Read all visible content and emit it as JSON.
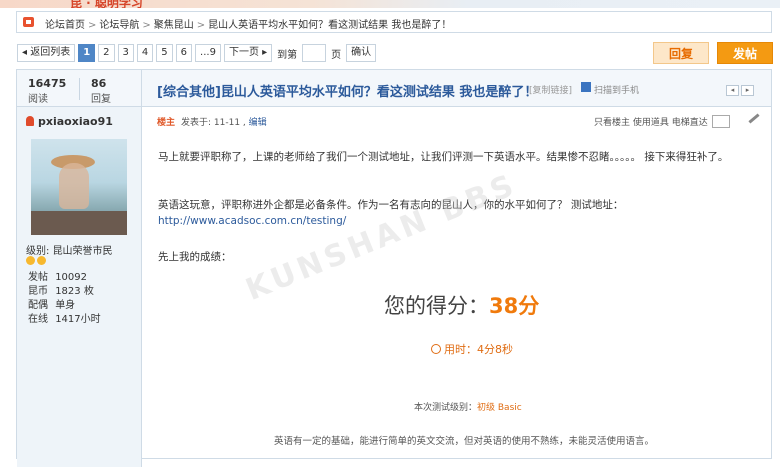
{
  "banner": {
    "text": "昆 · 聪明学习"
  },
  "breadcrumb": {
    "items": [
      "论坛首页",
      "论坛导航",
      "聚焦昆山",
      "昆山人英语平均水平如何？看这测试结果 我也是醉了！"
    ],
    "separator": ">"
  },
  "pager": {
    "back": "◂ 返回列表",
    "pages": [
      "1",
      "2",
      "3",
      "4",
      "5",
      "6",
      "...9"
    ],
    "next": "下一页 ▸",
    "goto_label": "到第",
    "page_unit": "页",
    "confirm": "确认"
  },
  "actions": {
    "reply": "回复",
    "post": "发帖"
  },
  "thread": {
    "views": "16475",
    "views_label": "阅读",
    "replies": "86",
    "replies_label": "回复",
    "title": "[综合其他]昆山人英语平均水平如何？看这测试结果 我也是醉了！",
    "copy_link": "[复制链接]",
    "scan": "扫描到手机"
  },
  "author": {
    "name": "pxiaoxiao91",
    "level_label": "级别:",
    "level": "昆山荣誉市民",
    "stats": [
      {
        "k": "发帖",
        "v": "10092"
      },
      {
        "k": "昆币",
        "v": "1823 枚"
      },
      {
        "k": "配偶",
        "v": "单身"
      },
      {
        "k": "在线",
        "v": "1417小时"
      }
    ]
  },
  "post": {
    "owner": "楼主",
    "posted": "发表于: 11-11 ,",
    "edit": "编辑",
    "tools": "只看楼主  使用道具  电梯直达",
    "p1": "马上就要评职称了，上课的老师给了我们一个测试地址，让我们评测一下英语水平。结果惨不忍睹。。。。。 接下来得狂补了。",
    "p2_a": "英语这玩意，评职称进外企都是必备条件。作为一名有志向的昆山人，你的水平如何了？ 测试地址：",
    "p2_link": "http://www.acadsoc.com.cn/testing/",
    "p3": "先上我的成绩：",
    "score_label": "您的得分：",
    "score_value": "38分",
    "time": "用时：4分8秒",
    "level_prefix": "本次测试级别：",
    "level_value": "初级 Basic",
    "summary": "英语有一定的基础，能进行简单的英文交流，但对英语的使用不熟练，未能灵活使用语言。"
  },
  "watermark": "KUNSHAN BBS",
  "colors": {
    "title": "#2c5a9b",
    "accent": "#f07a0c",
    "post_button": "#f49a12"
  }
}
